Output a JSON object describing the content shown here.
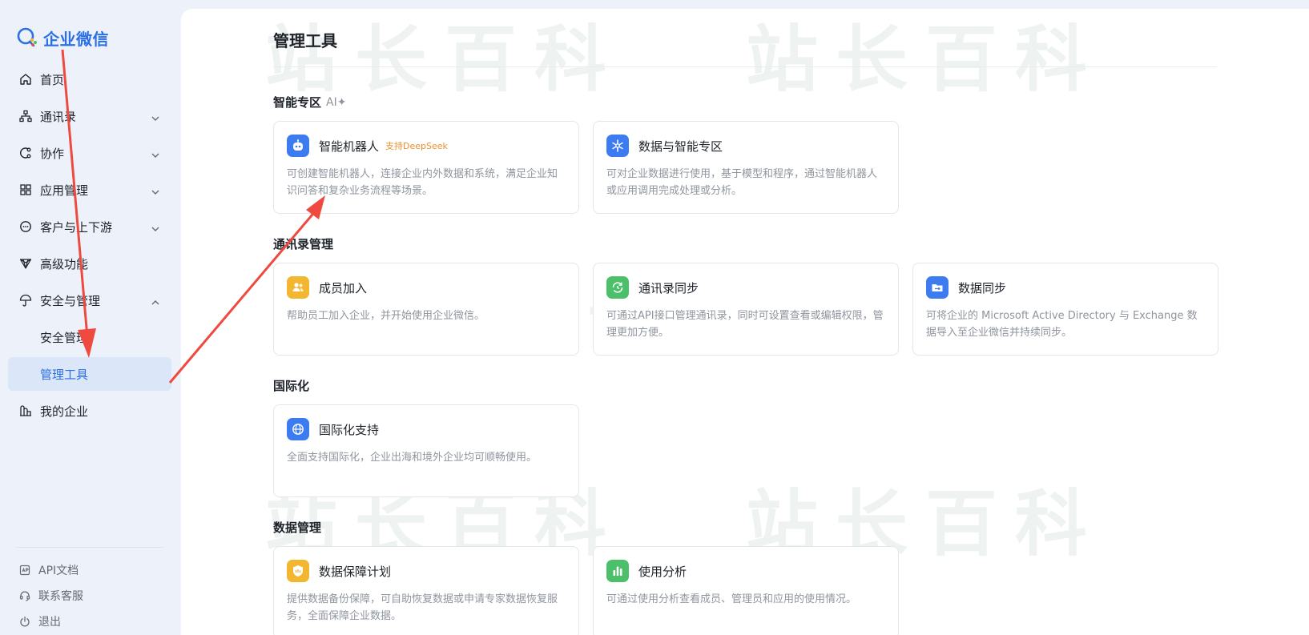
{
  "brand": {
    "name": "企业微信",
    "color": "#2b6fe6"
  },
  "sidebar": {
    "items": [
      {
        "label": "首页",
        "icon": "home-icon"
      },
      {
        "label": "通讯录",
        "icon": "org-chart-icon",
        "expandable": true
      },
      {
        "label": "协作",
        "icon": "collaboration-icon",
        "expandable": true
      },
      {
        "label": "应用管理",
        "icon": "apps-grid-icon",
        "expandable": true
      },
      {
        "label": "客户与上下游",
        "icon": "customer-chat-icon",
        "expandable": true
      },
      {
        "label": "高级功能",
        "icon": "diamond-icon"
      },
      {
        "label": "安全与管理",
        "icon": "umbrella-icon",
        "expandable": true,
        "expanded": true
      },
      {
        "label": "安全管理",
        "sub": true
      },
      {
        "label": "管理工具",
        "sub": true,
        "active": true
      },
      {
        "label": "我的企业",
        "icon": "building-icon"
      }
    ],
    "footer": [
      {
        "label": "API文档",
        "icon": "api-doc-icon"
      },
      {
        "label": "联系客服",
        "icon": "headset-icon"
      },
      {
        "label": "退出",
        "icon": "power-icon"
      }
    ]
  },
  "watermark": {
    "text": "站长百科"
  },
  "main": {
    "title": "管理工具",
    "sections": [
      {
        "title": "智能专区",
        "tag": "AI✦",
        "cards": [
          {
            "title": "智能机器人",
            "badge": "支持DeepSeek",
            "desc": "可创建智能机器人，连接企业内外数据和系统，满足企业知识问答和复杂业务流程等场景。",
            "icon": "robot-icon",
            "color": "#3d7bf0"
          },
          {
            "title": "数据与智能专区",
            "desc": "可对企业数据进行使用，基于模型和程序，通过智能机器人或应用调用完成处理或分析。",
            "icon": "snowflake-icon",
            "color": "#3d7bf0"
          }
        ]
      },
      {
        "title": "通讯录管理",
        "cards": [
          {
            "title": "成员加入",
            "desc": "帮助员工加入企业，并开始使用企业微信。",
            "icon": "members-icon",
            "color": "#f2b630"
          },
          {
            "title": "通讯录同步",
            "desc": "可通过API接口管理通讯录，同时可设置查看或编辑权限，管理更加方便。",
            "icon": "sync-icon",
            "color": "#4cbf6b"
          },
          {
            "title": "数据同步",
            "desc": "可将企业的 Microsoft Active Directory 与 Exchange 数据导入至企业微信并持续同步。",
            "icon": "folder-sync-icon",
            "color": "#3d7bf0"
          }
        ]
      },
      {
        "title": "国际化",
        "cards": [
          {
            "title": "国际化支持",
            "desc": "全面支持国际化，企业出海和境外企业均可顺畅使用。",
            "icon": "globe-icon",
            "color": "#3d7bf0"
          }
        ]
      },
      {
        "title": "数据管理",
        "cards": [
          {
            "title": "数据保障计划",
            "desc": "提供数据备份保障，可自助恢复数据或申请专家数据恢复服务，全面保障企业数据。",
            "icon": "shield-data-icon",
            "color": "#f2b630"
          },
          {
            "title": "使用分析",
            "desc": "可通过使用分析查看成员、管理员和应用的使用情况。",
            "icon": "bar-chart-icon",
            "color": "#4cbf6b"
          }
        ]
      }
    ]
  },
  "colors": {
    "accent": "#2b6fe6",
    "active_bg": "#dbe6f8",
    "annotation_arrow": "#ee4a40"
  }
}
